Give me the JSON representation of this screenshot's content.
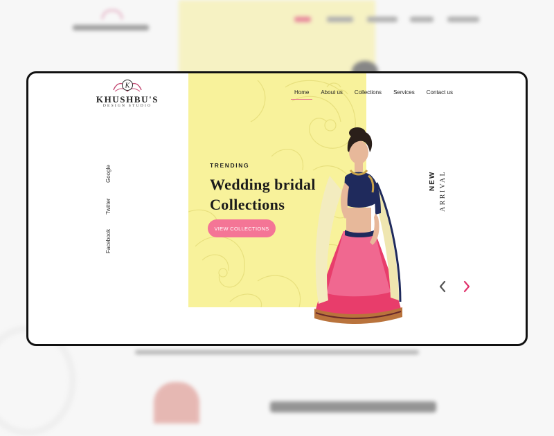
{
  "brand": {
    "name": "KHUSHBU'S",
    "tagline": "DESIGN STUDIO"
  },
  "nav": [
    {
      "label": "Home",
      "active": true
    },
    {
      "label": "About us",
      "active": false
    },
    {
      "label": "Collections",
      "active": false
    },
    {
      "label": "Services",
      "active": false
    },
    {
      "label": "Contact us",
      "active": false
    }
  ],
  "social": [
    "Google",
    "Twitter",
    "Facebook"
  ],
  "hero": {
    "eyebrow": "TRENDING",
    "headline_line1": "Wedding bridal",
    "headline_line2": "Collections",
    "cta": "VIEW COLLECTIONS"
  },
  "side_label": {
    "line1": "NEW",
    "line2": "ARRIVAL"
  },
  "icons": {
    "prev": "chevron-left-icon",
    "next": "chevron-right-icon",
    "logo_emblem": "monogram-k-icon"
  },
  "colors": {
    "accent_pink": "#f47596",
    "panel_yellow": "#f8f29b",
    "next_arrow": "#e0336c",
    "prev_arrow": "#555555"
  }
}
